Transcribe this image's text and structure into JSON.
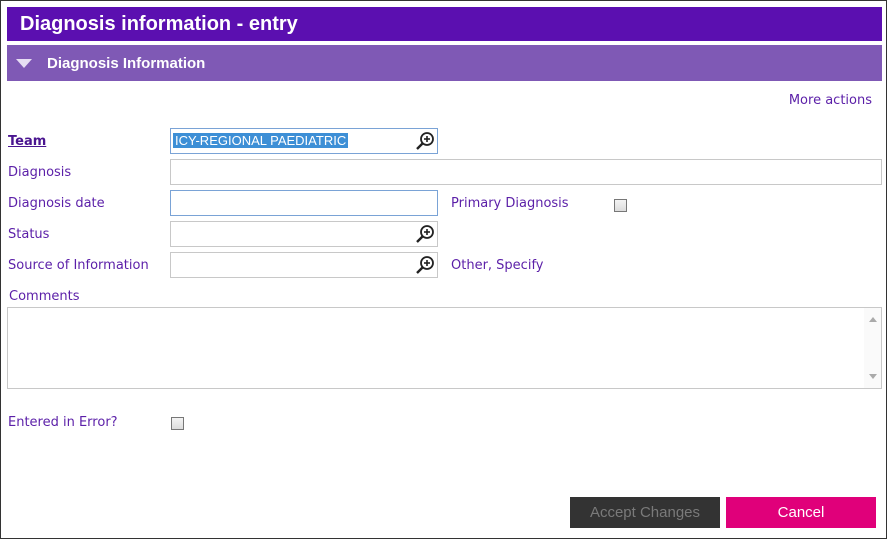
{
  "window": {
    "title": "Diagnosis information - entry"
  },
  "section": {
    "title": "Diagnosis Information"
  },
  "more_actions": "More actions",
  "labels": {
    "team": "Team",
    "diagnosis": "Diagnosis",
    "diagnosis_date": "Diagnosis date",
    "primary_diagnosis": "Primary Diagnosis",
    "status": "Status",
    "source_of_information": "Source of Information",
    "other_specify": "Other, Specify",
    "comments": "Comments",
    "entered_in_error": "Entered in Error?"
  },
  "fields": {
    "team_value": "ICY-REGIONAL PAEDIATRIC",
    "diagnosis_value": "",
    "diagnosis_date_value": "",
    "status_value": "",
    "source_value": "",
    "comments_value": ""
  },
  "checkboxes": {
    "primary_diagnosis": false,
    "entered_in_error": false
  },
  "buttons": {
    "accept": "Accept Changes",
    "cancel": "Cancel"
  },
  "colors": {
    "titlebar": "#5b0fb0",
    "section": "#7f59b5",
    "label": "#5b1fa8",
    "cancel": "#e0007a",
    "accept_disabled": "#333333"
  },
  "icons": {
    "lookup": "magnifier-plus-icon",
    "collapse": "triangle-down-icon"
  }
}
